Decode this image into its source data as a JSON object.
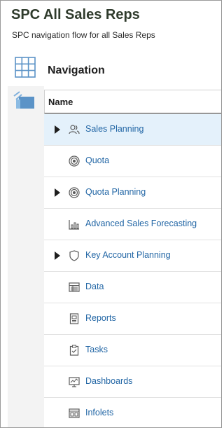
{
  "header": {
    "title": "SPC All Sales Reps",
    "subtitle": "SPC navigation flow for all Sales Reps"
  },
  "rail": {
    "tabs": [
      {
        "icon": "grid-icon",
        "selected": true
      },
      {
        "icon": "cards-stack-icon",
        "selected": false
      }
    ]
  },
  "navigation": {
    "title": "Navigation",
    "column_header": "Name",
    "items": [
      {
        "label": "Sales Planning",
        "icon": "users-icon",
        "expandable": true,
        "selected": true
      },
      {
        "label": "Quota",
        "icon": "target-icon",
        "expandable": false,
        "selected": false
      },
      {
        "label": "Quota Planning",
        "icon": "target-icon",
        "expandable": true,
        "selected": false
      },
      {
        "label": "Advanced Sales Forecasting",
        "icon": "bar-chart-icon",
        "expandable": false,
        "selected": false
      },
      {
        "label": "Key Account Planning",
        "icon": "shield-icon",
        "expandable": true,
        "selected": false
      },
      {
        "label": "Data",
        "icon": "data-form-icon",
        "expandable": false,
        "selected": false
      },
      {
        "label": "Reports",
        "icon": "report-icon",
        "expandable": false,
        "selected": false
      },
      {
        "label": "Tasks",
        "icon": "clipboard-check-icon",
        "expandable": false,
        "selected": false
      },
      {
        "label": "Dashboards",
        "icon": "dashboard-icon",
        "expandable": false,
        "selected": false
      },
      {
        "label": "Infolets",
        "icon": "infolets-icon",
        "expandable": false,
        "selected": false
      }
    ]
  },
  "colors": {
    "link": "#2266a5",
    "selected_row": "#e4f1fb",
    "title": "#2f3b2c",
    "rail_icon": "#5b93c7"
  }
}
